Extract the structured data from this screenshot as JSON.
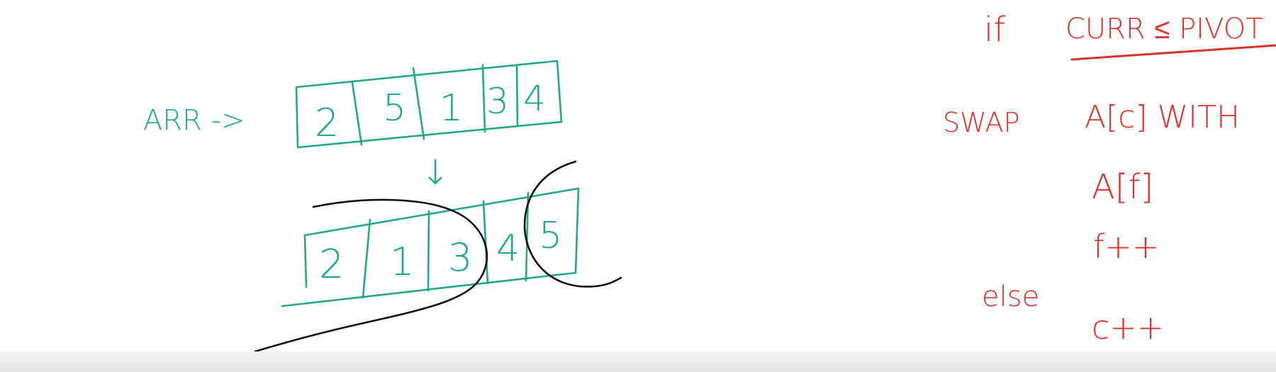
{
  "left_board": {
    "label": "ARR ->",
    "initial_array": [
      "2",
      "5",
      "1",
      "3",
      "4"
    ],
    "transition_mark": "↓",
    "partitioned_array": [
      "2",
      "1",
      "3",
      "4",
      "5"
    ]
  },
  "right_board": {
    "line_if": "if",
    "condition": "CURR ≤ PIVOT",
    "swap_keyword": "SWAP",
    "swap_target": "A[c] WITH",
    "swap_source": "A[f]",
    "increment_f": "f++",
    "else_keyword": "else",
    "increment_c": "c++"
  },
  "colors": {
    "teal_marker": "#25a888",
    "red_marker": "#d8322c",
    "black_marker": "#111111",
    "background": "#ffffff"
  }
}
